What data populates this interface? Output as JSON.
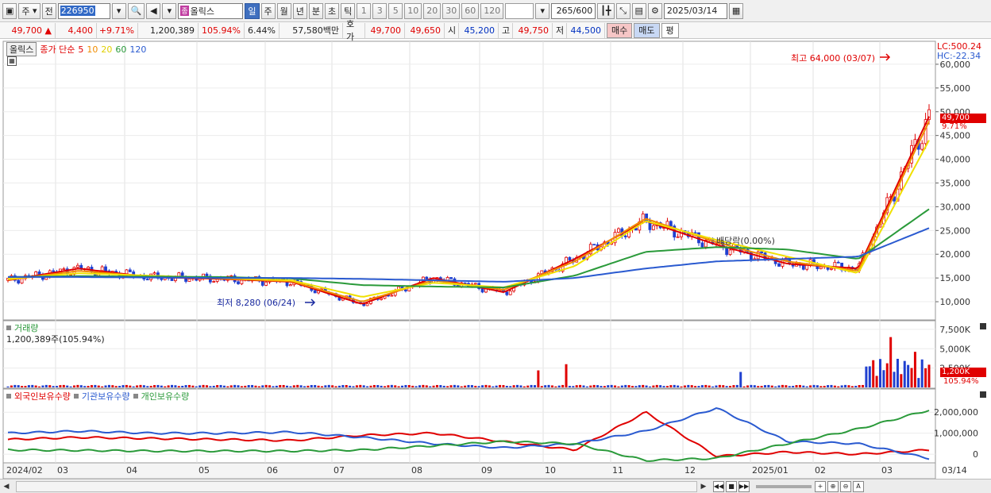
{
  "toolbar": {
    "type_label": "주",
    "prev_label": "전",
    "code": "226950",
    "name": "올릭스",
    "name_icon": "종",
    "periods": [
      "일",
      "주",
      "월",
      "년",
      "분",
      "초",
      "틱"
    ],
    "active_period": "일",
    "intervals": [
      "1",
      "3",
      "5",
      "10",
      "20",
      "30",
      "60",
      "120"
    ],
    "count": "265",
    "count_max": "/600",
    "date": "2025/03/14"
  },
  "quote": {
    "price": "49,700",
    "change_arrow": "▲",
    "change": "4,400",
    "change_pct": "+9.71%",
    "volume": "1,200,389",
    "volume_ratio": "105.94%",
    "turnover": "6.44%",
    "amount": "57,580백만",
    "hoga_label": "호가",
    "ask": "49,700",
    "bid": "49,650",
    "open_label": "시",
    "open": "45,200",
    "high_label": "고",
    "high": "49,750",
    "low_label": "저",
    "low": "44,500",
    "buy_label": "매수",
    "sell_label": "매도",
    "eval_label": "평"
  },
  "price_panel": {
    "stock_label": "올릭스",
    "indicator_label": "종가 단순",
    "ma_labels": [
      "5",
      "10",
      "20",
      "60",
      "120"
    ],
    "ma_colors": [
      "#e00000",
      "#f08c00",
      "#f0e000",
      "#2a9a3a",
      "#2a5ad0"
    ],
    "lc": "LC:500.24",
    "hc": "HC:-22.34",
    "current_price_tag": "49,700",
    "current_pct_tag": "9.71%",
    "high_annotation": "최고 64,000 (03/07)",
    "low_annotation": "최저 8,280 (06/24)",
    "event_annotation": "배당락(0.00%)",
    "y_ticks": [
      "60,000",
      "55,000",
      "50,000",
      "45,000",
      "40,000",
      "35,000",
      "30,000",
      "25,000",
      "20,000",
      "15,000",
      "10,000"
    ]
  },
  "volume_panel": {
    "title": "거래량",
    "value": "1,200,389주(105.94%)",
    "y_ticks": [
      "7,500K",
      "5,000K",
      "2,500K"
    ],
    "tag_value": "1,200K",
    "tag_pct": "105.94%"
  },
  "holdings_panel": {
    "titles": [
      "외국인보유수량",
      "기관보유수량",
      "개인보유수량"
    ],
    "title_colors": [
      "#e00000",
      "#2a5ad0",
      "#2a9a3a"
    ],
    "y_ticks": [
      "2,000,000",
      "1,000,000",
      "0"
    ]
  },
  "x_axis": {
    "labels": [
      "2024/02",
      "03",
      "04",
      "05",
      "06",
      "07",
      "08",
      "09",
      "10",
      "11",
      "12",
      "2025/01",
      "02",
      "03"
    ],
    "right_label": "03/14"
  },
  "chart_data": {
    "type": "line",
    "x": [
      "2024/02",
      "03",
      "04",
      "05",
      "06",
      "07",
      "08",
      "09",
      "10",
      "11",
      "12",
      "2025/01",
      "02",
      "03"
    ],
    "series": [
      {
        "name": "종가 단순 5",
        "values": [
          14500,
          17000,
          15200,
          14800,
          14200,
          9500,
          15000,
          12000,
          19000,
          27000,
          22000,
          18000,
          17000,
          49000
        ]
      },
      {
        "name": "종가 단순 10",
        "values": [
          14600,
          16500,
          15300,
          14900,
          14300,
          10000,
          14500,
          12500,
          18500,
          27500,
          22500,
          18500,
          16500,
          48000
        ]
      },
      {
        "name": "종가 단순 20",
        "values": [
          14800,
          16000,
          15500,
          15000,
          14500,
          11000,
          14000,
          13000,
          17500,
          27000,
          23000,
          19500,
          16000,
          44000
        ]
      },
      {
        "name": "종가 단순 60",
        "values": [
          15200,
          15400,
          15300,
          15200,
          14900,
          13500,
          13200,
          13000,
          15500,
          20500,
          21500,
          21000,
          19000,
          29500
        ]
      },
      {
        "name": "종가 단순 120",
        "values": [
          15200,
          15200,
          15100,
          15000,
          15000,
          14800,
          14500,
          14200,
          15000,
          17000,
          18500,
          19000,
          19500,
          25500
        ]
      }
    ],
    "ylim": [
      7000,
      64000
    ],
    "annotations": [
      "최고 64,000 (03/07)",
      "최저 8,280 (06/24)"
    ]
  }
}
